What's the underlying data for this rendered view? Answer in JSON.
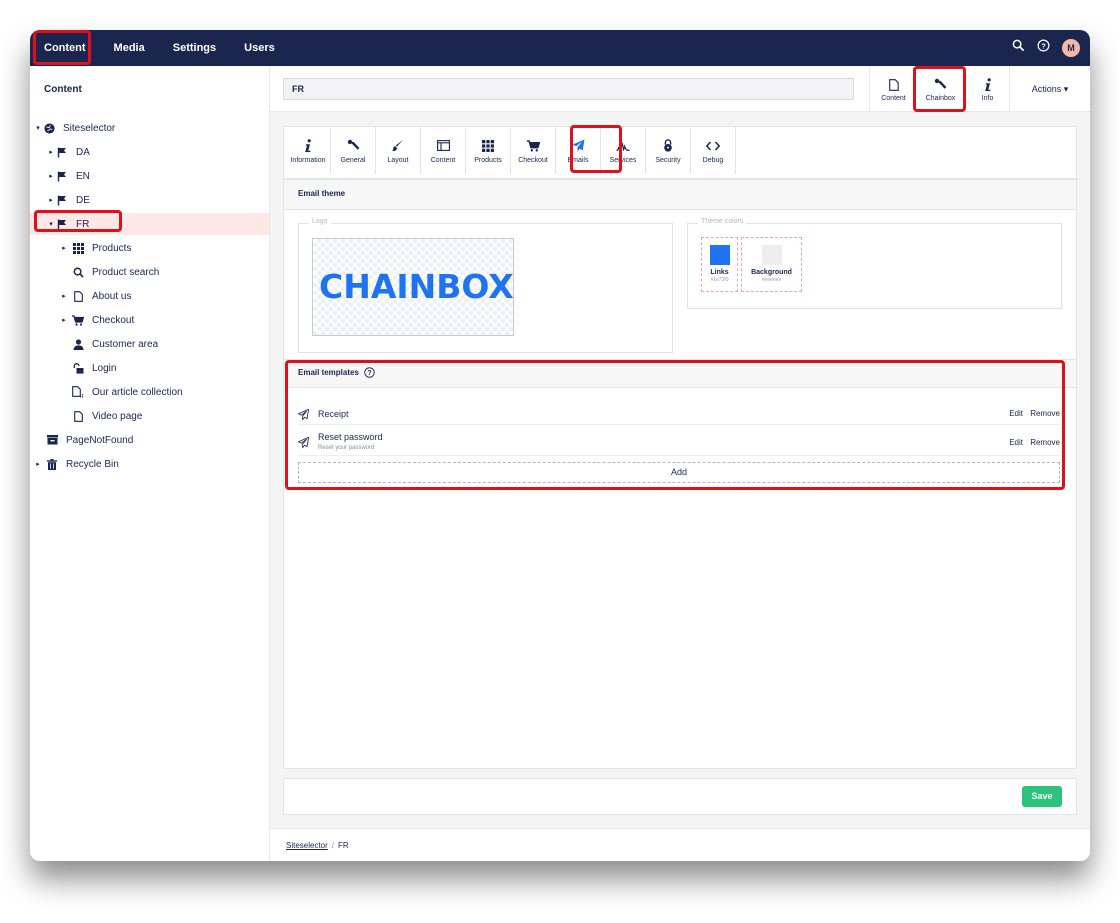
{
  "topnav": {
    "items": [
      "Content",
      "Media",
      "Settings",
      "Users"
    ],
    "user_initial": "M"
  },
  "sidebar": {
    "title": "Content",
    "tree": [
      {
        "label": "Siteselector",
        "icon": "globe-icon",
        "caret": "▾"
      },
      {
        "label": "DA",
        "icon": "flag-icon",
        "caret": "▸"
      },
      {
        "label": "EN",
        "icon": "flag-icon",
        "caret": "▸"
      },
      {
        "label": "DE",
        "icon": "flag-icon",
        "caret": "▸"
      },
      {
        "label": "FR",
        "icon": "flag-icon",
        "caret": "▾",
        "active": true
      },
      {
        "label": "Products",
        "icon": "grid-icon",
        "caret": "▸"
      },
      {
        "label": "Product search",
        "icon": "search-icon",
        "caret": ""
      },
      {
        "label": "About us",
        "icon": "document-icon",
        "caret": "▸"
      },
      {
        "label": "Checkout",
        "icon": "cart-icon",
        "caret": "▸"
      },
      {
        "label": "Customer area",
        "icon": "user-icon",
        "caret": ""
      },
      {
        "label": "Login",
        "icon": "unlock-icon",
        "caret": ""
      },
      {
        "label": "Our article collection",
        "icon": "documents-icon",
        "caret": ""
      },
      {
        "label": "Video page",
        "icon": "document-icon",
        "caret": ""
      },
      {
        "label": "PageNotFound",
        "icon": "box-icon",
        "caret": ""
      },
      {
        "label": "Recycle Bin",
        "icon": "trash-icon",
        "caret": "▸"
      }
    ]
  },
  "header": {
    "node_name": "FR",
    "apps": [
      {
        "label": "Content",
        "icon": "document-icon"
      },
      {
        "label": "Chainbox",
        "icon": "wrench-icon"
      },
      {
        "label": "Info",
        "icon": "info-icon"
      }
    ],
    "actions_label": "Actions ▾"
  },
  "tabs": [
    {
      "label": "Information",
      "icon": "info-icon"
    },
    {
      "label": "General",
      "icon": "wrench-icon"
    },
    {
      "label": "Layout",
      "icon": "brush-icon"
    },
    {
      "label": "Content",
      "icon": "layout-icon"
    },
    {
      "label": "Products",
      "icon": "grid-icon"
    },
    {
      "label": "Checkout",
      "icon": "cart-icon"
    },
    {
      "label": "Emails",
      "icon": "paper-plane-icon",
      "active": true
    },
    {
      "label": "Services",
      "icon": "services-icon"
    },
    {
      "label": "Security",
      "icon": "lock-icon"
    },
    {
      "label": "Debug",
      "icon": "code-icon"
    }
  ],
  "email_theme": {
    "title": "Email theme",
    "logo_legend": "Logo",
    "logo_text": "CHAINBOX",
    "colors_legend": "Theme colors",
    "colors": [
      {
        "name": "Links",
        "value": "#1e73f0",
        "color": "#1e73f0"
      },
      {
        "name": "Background",
        "value": "#eeeeee",
        "color": "#eeeeee"
      }
    ]
  },
  "email_templates": {
    "title": "Email templates",
    "items": [
      {
        "name": "Receipt",
        "description": ""
      },
      {
        "name": "Reset password",
        "description": "Reset your password"
      }
    ],
    "edit_label": "Edit",
    "remove_label": "Remove",
    "add_label": "Add"
  },
  "footer": {
    "save_label": "Save"
  },
  "breadcrumb": {
    "items": [
      "Siteselector",
      "FR"
    ],
    "separator": "/"
  },
  "colors": {
    "topbar": "#1b264f",
    "highlight": "#e0101a",
    "save": "#2bc37c",
    "accent": "#1e73f0"
  }
}
